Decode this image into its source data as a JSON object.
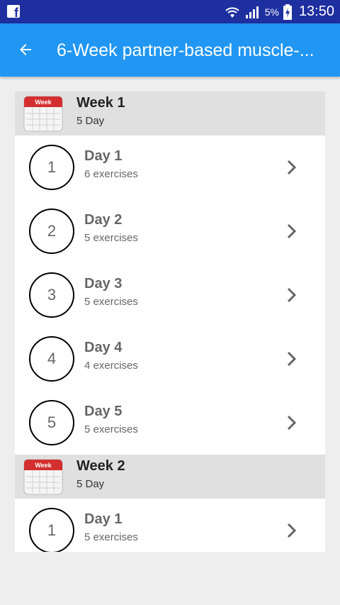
{
  "status_bar": {
    "battery": "5%",
    "time": "13:50"
  },
  "app_bar": {
    "title": "6-Week partner-based muscle-..."
  },
  "icons": {
    "notification": "facebook-icon",
    "back": "arrow-left-icon",
    "calendar": "calendar-icon",
    "chevron": "chevron-right-icon",
    "calendar_label": "Week"
  },
  "colors": {
    "status_bar": "#1e2fa0",
    "app_bar": "#2196f3",
    "week_header": "#e0e0e0",
    "calendar_red": "#d32f2f"
  },
  "weeks": [
    {
      "title": "Week 1",
      "subtitle": "5 Day",
      "days": [
        {
          "number": "1",
          "title": "Day 1",
          "subtitle": "6 exercises"
        },
        {
          "number": "2",
          "title": "Day 2",
          "subtitle": "5 exercises"
        },
        {
          "number": "3",
          "title": "Day 3",
          "subtitle": "5 exercises"
        },
        {
          "number": "4",
          "title": "Day 4",
          "subtitle": "4 exercises"
        },
        {
          "number": "5",
          "title": "Day 5",
          "subtitle": "5 exercises"
        }
      ]
    },
    {
      "title": "Week 2",
      "subtitle": "5 Day",
      "days": [
        {
          "number": "1",
          "title": "Day 1",
          "subtitle": "5 exercises"
        }
      ]
    }
  ]
}
